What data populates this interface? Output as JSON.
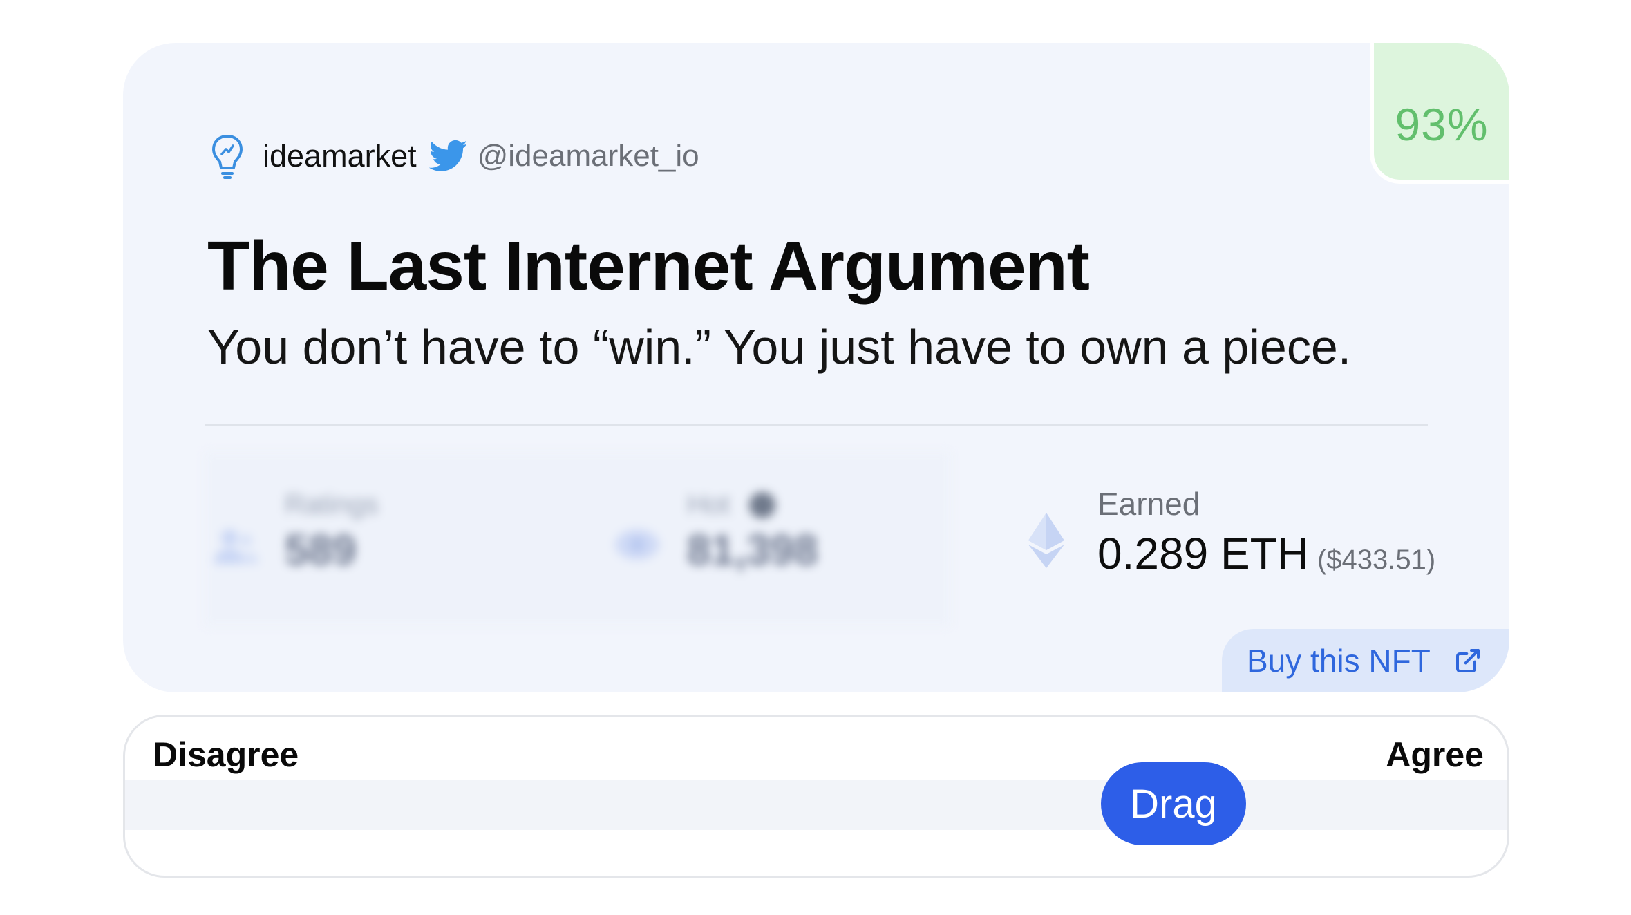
{
  "card": {
    "percent": "93%",
    "brand": {
      "name": "ideamarket",
      "handle": "@ideamarket_io",
      "logo_icon": "lightbulb-icon",
      "social_icon": "twitter-icon"
    },
    "title": "The Last Internet Argument",
    "subtitle": "You don’t have to “win.” You just have to own a piece.",
    "stats": [
      {
        "label": "Ratings",
        "value": "589",
        "icon": "users-icon"
      },
      {
        "label": "Hot",
        "value": "81,398",
        "icon": "eye-icon"
      }
    ],
    "earned": {
      "label": "Earned",
      "value": "0.289 ETH",
      "usd": "($433.51)",
      "icon": "ethereum-icon"
    },
    "buy_button": {
      "label": "Buy this NFT",
      "icon": "external-link-icon"
    }
  },
  "slider": {
    "left_label": "Disagree",
    "right_label": "Agree",
    "handle_label": "Drag",
    "value_fraction": 0.78
  },
  "colors": {
    "accent": "#2d5ee8",
    "badge_green": "#62bf6d",
    "card_bg": "#f2f5fc"
  }
}
